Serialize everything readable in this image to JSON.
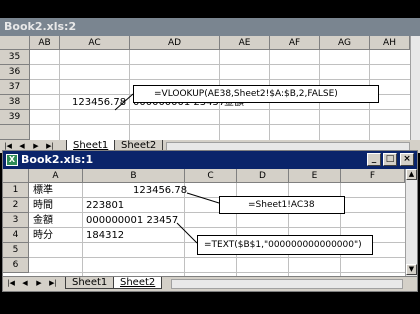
{
  "window1": {
    "title": "Book2.xls:2",
    "columns": [
      "AB",
      "AC",
      "AD",
      "AE",
      "AF",
      "AG",
      "AH"
    ],
    "rows": [
      "35",
      "36",
      "37",
      "38",
      "39"
    ],
    "cells": {
      "ac38": "123456.78",
      "ad38": "000000001 23457",
      "ae38": "金額"
    },
    "callout": "=VLOOKUP(AE38,Sheet2!$A:$B,2,FALSE)",
    "tabs": [
      "Sheet1",
      "Sheet2"
    ],
    "active_tab": "Sheet1"
  },
  "window2": {
    "title": "Book2.xls:1",
    "controls": {
      "minimize": "_",
      "restore": "□",
      "close": "×"
    },
    "columns": [
      "A",
      "B",
      "C",
      "D",
      "E",
      "F"
    ],
    "rows": [
      "1",
      "2",
      "3",
      "4",
      "5",
      "6"
    ],
    "cells": {
      "a1": "標準",
      "b1": "123456.78",
      "a2": "時間",
      "b2": "223801",
      "a3": "金額",
      "b3": "000000001 23457",
      "a4": "時分",
      "b4": "184312"
    },
    "callout_ref": "=Sheet1!AC38",
    "callout_text": "=TEXT($B$1,\"000000000000000\")",
    "tabs": [
      "Sheet1",
      "Sheet2"
    ],
    "active_tab": "Sheet2"
  },
  "nav_icons": [
    "first-sheet-icon",
    "prev-sheet-icon",
    "next-sheet-icon",
    "last-sheet-icon"
  ],
  "colors": {
    "active_titlebar": "#0a246a",
    "inactive_titlebar": "#7a8590",
    "chrome": "#d4d0c8"
  }
}
